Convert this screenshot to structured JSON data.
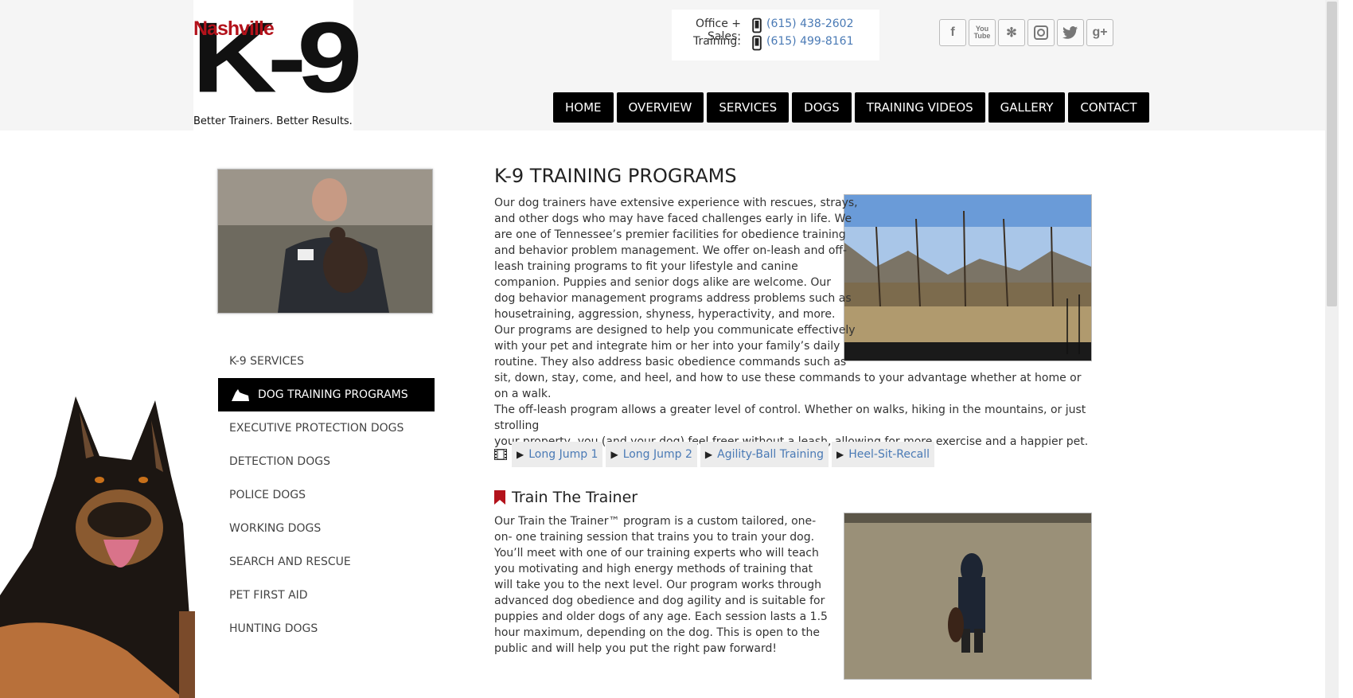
{
  "header": {
    "logo": {
      "brand_top": "Nashville",
      "brand_mark": "K-9",
      "tagline": "Better Trainers. Better Results."
    },
    "contact": {
      "office_label": "Office + Sales:",
      "office_phone": "(615) 438-2602",
      "training_label": "Training:",
      "training_phone": "(615) 499-8161"
    },
    "social_icons": [
      "facebook-icon",
      "youtube-icon",
      "yelp-icon",
      "instagram-icon",
      "twitter-icon",
      "googleplus-icon"
    ],
    "nav": [
      "HOME",
      "OVERVIEW",
      "SERVICES",
      "DOGS",
      "TRAINING VIDEOS",
      "GALLERY",
      "CONTACT"
    ]
  },
  "sidebar": {
    "items": [
      {
        "label": "K-9 SERVICES",
        "active": false
      },
      {
        "label": "DOG TRAINING PROGRAMS",
        "active": true
      },
      {
        "label": "EXECUTIVE PROTECTION DOGS",
        "active": false
      },
      {
        "label": "DETECTION DOGS",
        "active": false
      },
      {
        "label": "POLICE DOGS",
        "active": false
      },
      {
        "label": "WORKING DOGS",
        "active": false
      },
      {
        "label": "SEARCH AND RESCUE",
        "active": false
      },
      {
        "label": "PET FIRST AID",
        "active": false
      },
      {
        "label": "HUNTING DOGS",
        "active": false
      }
    ]
  },
  "main": {
    "title": "K-9 TRAINING PROGRAMS",
    "intro_lines": [
      "Our dog trainers have extensive experience with rescues, strays,",
      "and other dogs who may have faced challenges early in life. We",
      "are one of Tennessee’s premier facilities for obedience training",
      "and behavior problem management. We offer on-leash and off-",
      "leash training programs to fit your lifestyle and canine",
      "companion. Puppies and senior dogs alike are welcome. Our",
      "dog behavior management programs address problems such as",
      "housetraining, aggression, shyness, hyperactivity, and more.",
      "Our programs are designed to help you communicate effectively",
      "with your pet and integrate him or her into your family’s daily",
      "routine. They also address basic obedience commands such as",
      "sit, down, stay, come, and heel, and how to use these commands to your advantage whether at home or on a walk.",
      "The off-leash program allows a greater level of control. Whether on walks, hiking in the mountains, or just strolling",
      "your property, you (and your dog) feel freer without a leash, allowing for more exercise and a happier pet."
    ],
    "videos": [
      "Long Jump 1",
      "Long Jump 2",
      "Agility-Ball Training",
      "Heel-Sit-Recall"
    ],
    "trainer": {
      "heading": "Train The Trainer",
      "lines": [
        "Our Train the Trainer™ program is a custom tailored, one-on-",
        "one training session that trains you to train your dog. You’ll",
        "meet with one of our training experts who will teach you",
        "motivating and high energy methods of training that will take",
        "you to the next level. Our program works through advanced dog",
        "obedience and dog agility and is suitable for puppies and older",
        "dogs of any age. Each session lasts a 1.5 hour maximum,",
        "depending on the dog. This is open to the public and will help",
        "you put the right paw forward!"
      ]
    }
  },
  "colors": {
    "brand_red": "#b3121b",
    "nav_bg": "#000000",
    "link_blue": "#4a7ab5"
  }
}
